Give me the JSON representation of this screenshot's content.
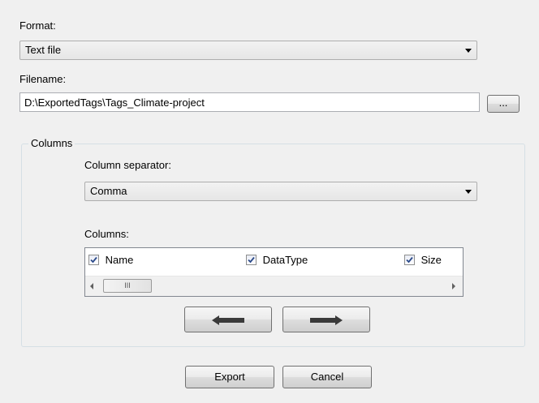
{
  "format": {
    "label": "Format:",
    "selected": "Text file"
  },
  "filename": {
    "label": "Filename:",
    "value": "D:\\ExportedTags\\Tags_Climate-project",
    "browse_label": "..."
  },
  "columns_group": {
    "title": "Columns",
    "separator_label": "Column separator:",
    "separator_selected": "Comma",
    "columns_label": "Columns:",
    "items": [
      {
        "label": "Name",
        "checked": true
      },
      {
        "label": "DataType",
        "checked": true
      },
      {
        "label": "Size",
        "checked": true
      }
    ],
    "scroll_thumb_glyph": "III",
    "left_button_icon": "arrow-left-icon",
    "right_button_icon": "arrow-right-icon"
  },
  "footer": {
    "export_label": "Export",
    "cancel_label": "Cancel"
  }
}
